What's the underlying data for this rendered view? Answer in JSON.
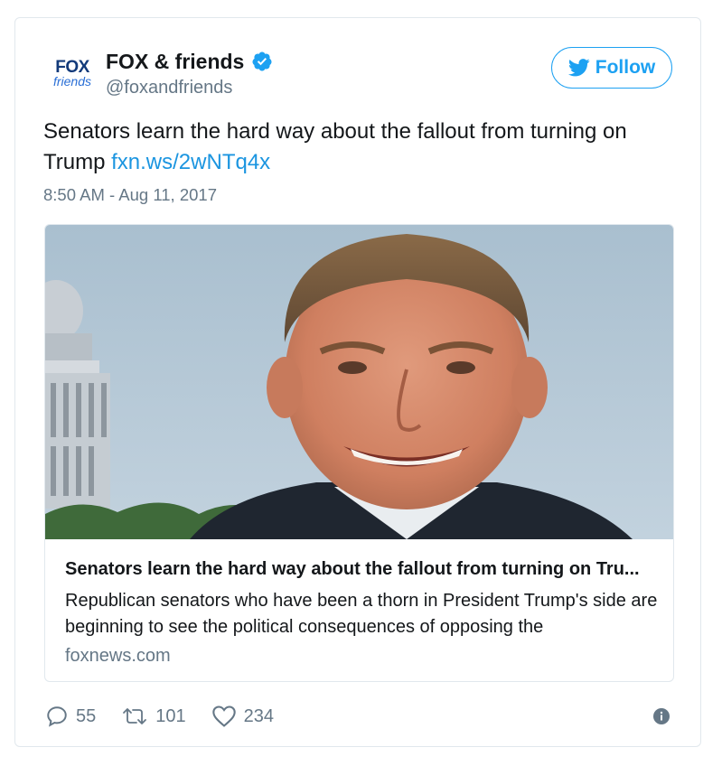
{
  "account": {
    "name": "FOX & friends",
    "handle": "@foxandfriends",
    "verified": true,
    "avatar_logo_top": "FOX",
    "avatar_logo_bottom": "friends"
  },
  "follow_button": {
    "label": "Follow"
  },
  "tweet": {
    "text": "Senators learn the hard way about the fallout from turning on Trump",
    "link": "fxn.ws/2wNTq4x",
    "timestamp": "8:50 AM - Aug 11, 2017"
  },
  "link_card": {
    "title": "Senators learn the hard way about the fallout from turning on Tru...",
    "description": "Republican senators who have been a thorn in President Trump's side are beginning to see the political consequences of opposing the",
    "domain": "foxnews.com"
  },
  "stats": {
    "replies": "55",
    "retweets": "101",
    "likes": "234"
  },
  "colors": {
    "twitter_blue": "#1da1f2",
    "link_blue": "#1b95e0",
    "secondary_text": "#657786",
    "border": "#e1e8ed"
  },
  "icons": [
    "verified-badge-icon",
    "twitter-bird-icon",
    "reply-icon",
    "retweet-icon",
    "heart-icon",
    "info-icon"
  ]
}
